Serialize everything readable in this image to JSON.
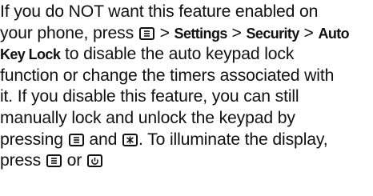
{
  "paragraph": {
    "l1": "If you do NOT want this feature enabled on",
    "l2a": "your phone, press",
    "l2b": ">",
    "l2c": "Settings",
    "l2d": ">",
    "l2e": "Security",
    "l2f": ">",
    "l2g": "Auto",
    "l3a": "Key Lock",
    "l3b": "to disable the auto keypad lock",
    "l4": "function or change the timers associated with",
    "l5": "it. If you disable this feature, you can still",
    "l6": "manually lock and unlock the keypad by",
    "l7a": "pressing",
    "l7b": "and",
    "l7c": ". To illuminate the display,",
    "l8a": "press",
    "l8b": "or"
  },
  "icons": {
    "menu_key": "menu-key-icon",
    "star_key": "star-key-icon",
    "power_key": "power-end-key-icon"
  }
}
